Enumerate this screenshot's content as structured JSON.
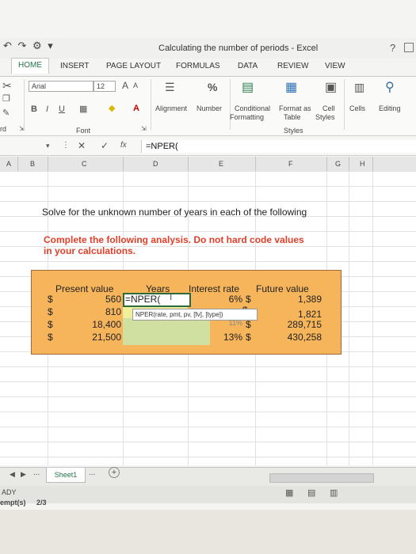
{
  "window": {
    "title": "Calculating the number of periods - Excel",
    "help": "?"
  },
  "quick_access": "↶ ↷ ⚙ ▾",
  "tabs": [
    "HOME",
    "INSERT",
    "PAGE LAYOUT",
    "FORMULAS",
    "DATA",
    "REVIEW",
    "VIEW"
  ],
  "ribbon": {
    "font_name": "Arial",
    "font_size": "12",
    "grow_font": "A",
    "shrink_font": "A",
    "bold": "B",
    "italic": "I",
    "underline": "U",
    "font_group_label": "Font",
    "alignment_label": "Alignment",
    "number_label": "Number",
    "percent": "%",
    "conditional_formatting": [
      "Conditional",
      "Formatting"
    ],
    "format_as_table": [
      "Format as",
      "Table"
    ],
    "cell_styles": [
      "Cell",
      "Styles"
    ],
    "styles_group_label": "Styles",
    "cells_label": "Cells",
    "editing_label": "Editing",
    "clipboard_partial": "rd"
  },
  "formula_bar": {
    "cancel": "✕",
    "enter": "✓",
    "fx": "fx",
    "content": "=NPER("
  },
  "columns": [
    "A",
    "B",
    "C",
    "D",
    "E",
    "F",
    "G",
    "H"
  ],
  "sheet": {
    "heading": "Solve for the unknown number of years in each of the following",
    "instruction_line1": "Complete the following analysis. Do not hard code values",
    "instruction_line2": "in your calculations."
  },
  "table": {
    "headers": {
      "present_value": "Present value",
      "years": "Years",
      "interest_rate": "Interest rate",
      "future_value": "Future value"
    },
    "currency": "$",
    "rows": [
      {
        "pv": "560",
        "years": "=NPER(",
        "rate": "6%",
        "fv": "1,389"
      },
      {
        "pv": "810",
        "years": "",
        "rate": "",
        "fv": "1,821"
      },
      {
        "pv": "18,400",
        "years": "",
        "rate": "11%",
        "fv": "289,715"
      },
      {
        "pv": "21,500",
        "years": "",
        "rate": "13%",
        "fv": "430,258"
      }
    ],
    "tooltip": "NPER(rate, pmt, pv, [fv], [type])"
  },
  "bottom": {
    "sheet_tab": "Sheet1",
    "more_sheets": "...",
    "add_sheet": "+",
    "status_ready": "ADY",
    "status_empty": "empt(s)",
    "status_count": "2/3"
  }
}
